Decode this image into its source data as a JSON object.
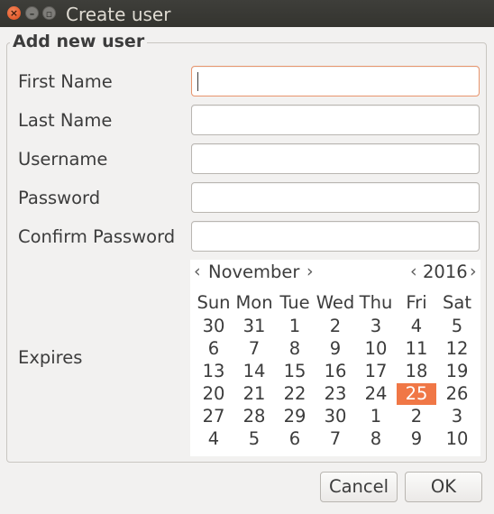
{
  "window": {
    "title": "Create user",
    "close_glyph": "×",
    "min_glyph": "–",
    "max_glyph": "▫"
  },
  "frame_title": "Add new user",
  "fields": {
    "first_name": {
      "label": "First Name",
      "value": ""
    },
    "last_name": {
      "label": "Last Name",
      "value": ""
    },
    "username": {
      "label": "Username",
      "value": ""
    },
    "password": {
      "label": "Password",
      "value": ""
    },
    "confirm_password": {
      "label": "Confirm Password",
      "value": ""
    }
  },
  "expires": {
    "label": "Expires",
    "month": "November",
    "year": "2016",
    "prev_glyph": "‹",
    "next_glyph": "›",
    "weekdays": [
      "Sun",
      "Mon",
      "Tue",
      "Wed",
      "Thu",
      "Fri",
      "Sat"
    ],
    "weeks": [
      [
        "30",
        "31",
        "1",
        "2",
        "3",
        "4",
        "5"
      ],
      [
        "6",
        "7",
        "8",
        "9",
        "10",
        "11",
        "12"
      ],
      [
        "13",
        "14",
        "15",
        "16",
        "17",
        "18",
        "19"
      ],
      [
        "20",
        "21",
        "22",
        "23",
        "24",
        "25",
        "26"
      ],
      [
        "27",
        "28",
        "29",
        "30",
        "1",
        "2",
        "3"
      ],
      [
        "4",
        "5",
        "6",
        "7",
        "8",
        "9",
        "10"
      ]
    ],
    "selected_day": "25",
    "selected_color": "#f07746"
  },
  "buttons": {
    "cancel": "Cancel",
    "ok": "OK"
  }
}
